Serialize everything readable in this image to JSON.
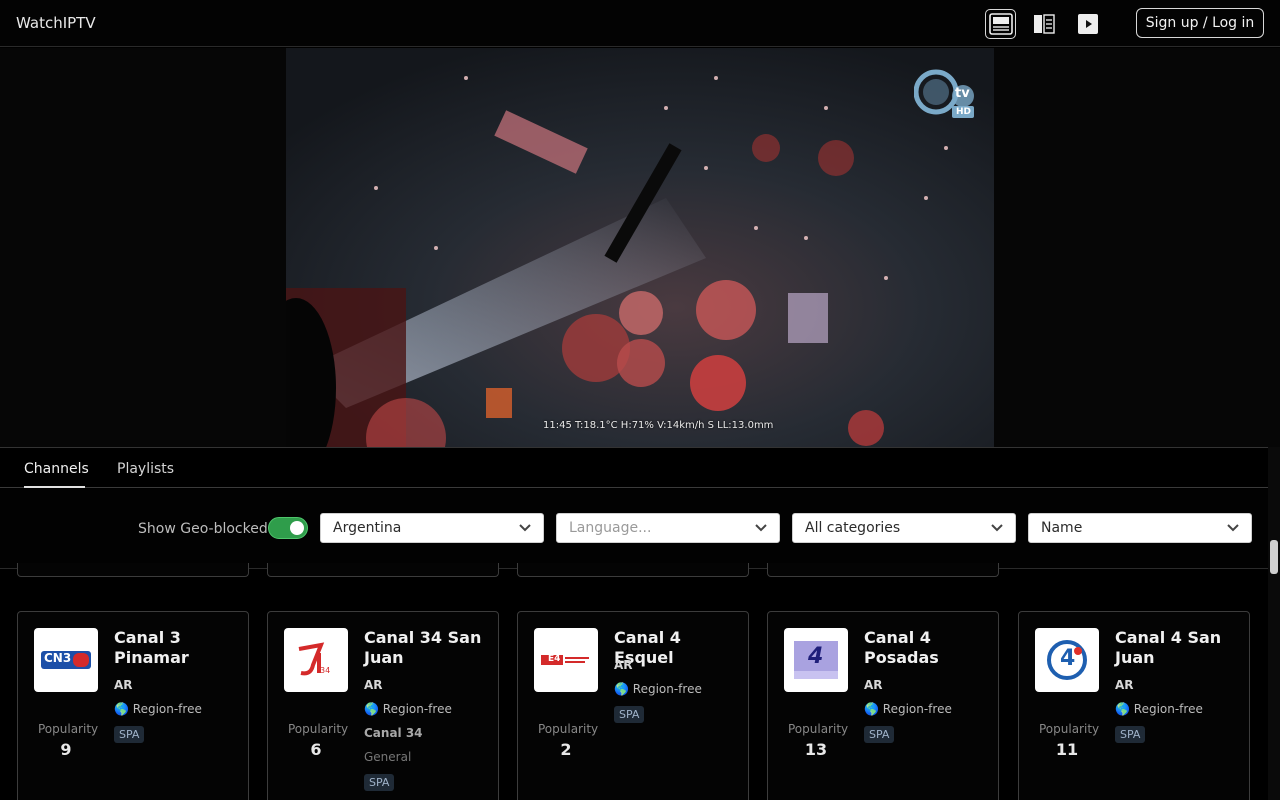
{
  "app": {
    "title": "WatchIPTV"
  },
  "header": {
    "auth_label": "Sign up / Log in"
  },
  "player": {
    "osd_text": "11:45 T:18.1°C H:71% V:14km/h S LL:13.0mm",
    "channel_logo_text": "tv",
    "channel_logo_badge": "HD"
  },
  "tabs": [
    {
      "label": "Channels",
      "active": true
    },
    {
      "label": "Playlists",
      "active": false
    }
  ],
  "filters": {
    "geo_label": "Show Geo-blocked",
    "geo_enabled": true,
    "country": "Argentina",
    "language_placeholder": "Language...",
    "category": "All categories",
    "sort": "Name"
  },
  "channels": [
    {
      "name": "Canal 3 Pinamar",
      "country": "AR",
      "region": "Region-free",
      "subtitle": "",
      "category": "",
      "language": "SPA",
      "popularity_label": "Popularity",
      "popularity": "9",
      "logo_text": "CN3"
    },
    {
      "name": "Canal 34 San Juan",
      "country": "AR",
      "region": "Region-free",
      "subtitle": "Canal 34",
      "category": "General",
      "language": "SPA",
      "popularity_label": "Popularity",
      "popularity": "6",
      "logo_text": "34"
    },
    {
      "name": "Canal 4 Esquel",
      "country": "AR",
      "region": "Region-free",
      "subtitle": "",
      "category": "",
      "language": "SPA",
      "popularity_label": "Popularity",
      "popularity": "2",
      "logo_text": "E4"
    },
    {
      "name": "Canal 4 Posadas",
      "country": "AR",
      "region": "Region-free",
      "subtitle": "",
      "category": "",
      "language": "SPA",
      "popularity_label": "Popularity",
      "popularity": "13",
      "logo_text": "4"
    },
    {
      "name": "Canal 4 San Juan",
      "country": "AR",
      "region": "Region-free",
      "subtitle": "",
      "category": "",
      "language": "SPA",
      "popularity_label": "Popularity",
      "popularity": "11",
      "logo_text": "4"
    }
  ],
  "colors": {
    "accent_toggle": "#2f9d4b",
    "background": "#000000",
    "lang_badge": "#1f2a36"
  },
  "icons": [
    "layout-stacked-icon",
    "layout-side-icon",
    "play-icon",
    "chevron-down-icon",
    "globe-icon"
  ]
}
